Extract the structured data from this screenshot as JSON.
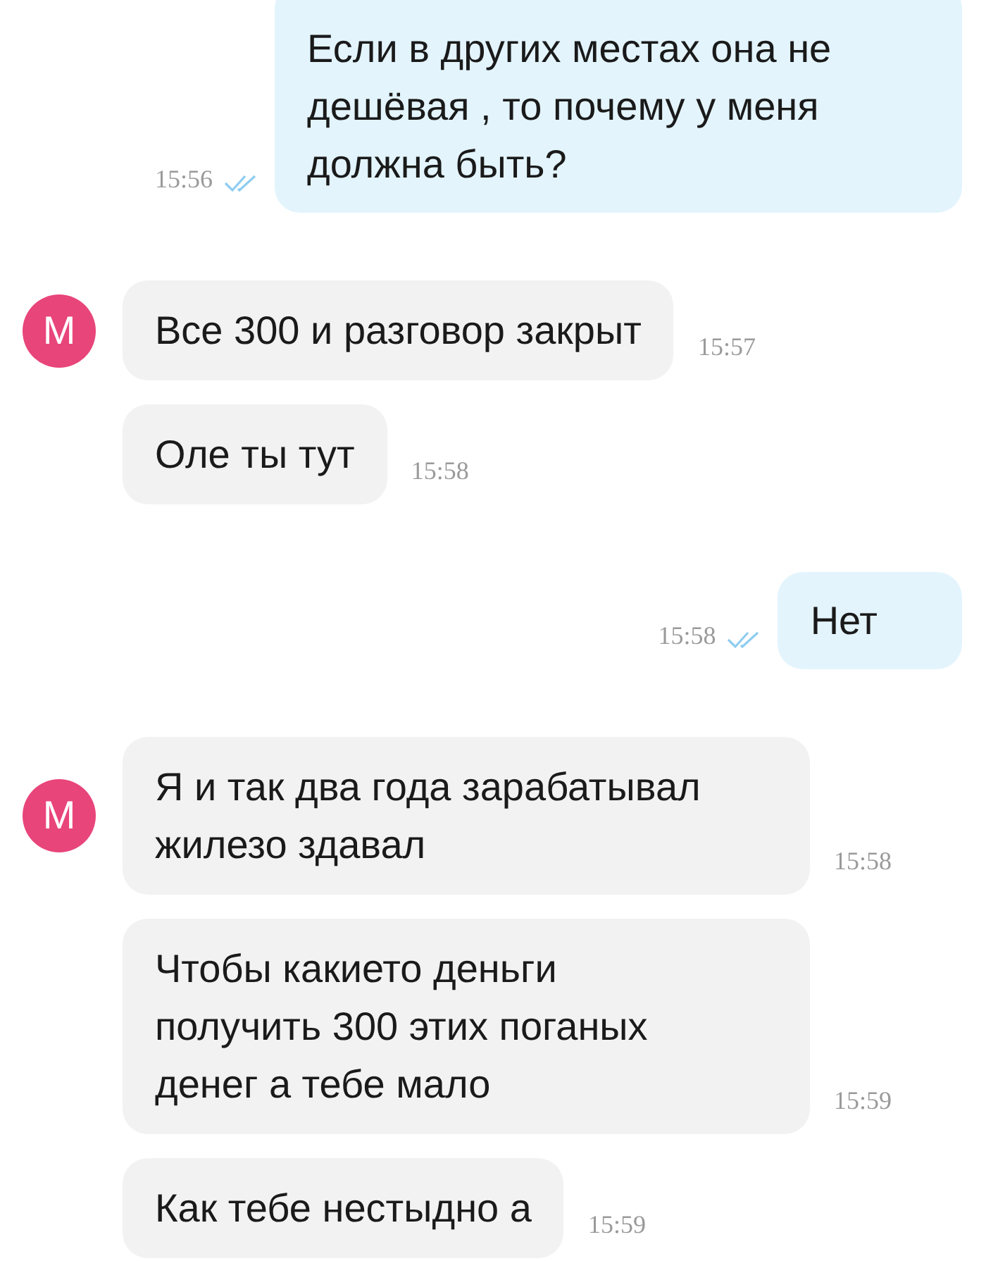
{
  "messages": [
    {
      "kind": "outgoing",
      "text": "Если в других местах она не дешёвая , то почему у меня должна быть?",
      "time": "15:56",
      "read": true
    },
    {
      "kind": "incoming",
      "avatar": "M",
      "text": "Все 300 и разговор закрыт",
      "time": "15:57"
    },
    {
      "kind": "incoming",
      "text": "Оле ты тут",
      "time": "15:58"
    },
    {
      "kind": "outgoing",
      "text": "Нет",
      "time": "15:58",
      "read": true
    },
    {
      "kind": "incoming",
      "avatar": "M",
      "text": "Я и так два года зарабатывал жилезо здавал",
      "time": "15:58"
    },
    {
      "kind": "incoming",
      "text": "Чтобы какието деньги получить 300 этих поганых денег а тебе мало",
      "time": "15:59"
    },
    {
      "kind": "incoming",
      "text": "Как тебе нестыдно а",
      "time": "15:59"
    }
  ]
}
